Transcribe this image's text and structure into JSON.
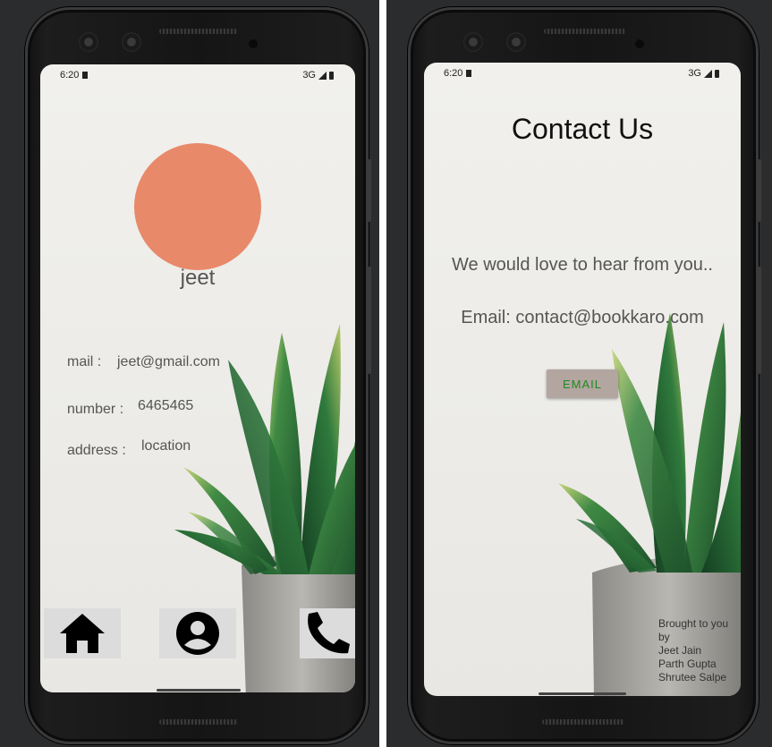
{
  "status_bar": {
    "time": "6:20",
    "network": "3G"
  },
  "profile": {
    "name": "jeet",
    "fields": [
      {
        "label": "mail :",
        "value": "jeet@gmail.com"
      },
      {
        "label": "number :",
        "value": "6465465"
      },
      {
        "label": "address :",
        "value": "location"
      }
    ],
    "avatar_color": "#e8896a"
  },
  "nav": {
    "items": [
      {
        "icon": "home-icon"
      },
      {
        "icon": "profile-icon"
      },
      {
        "icon": "phone-icon"
      }
    ]
  },
  "contact": {
    "title": "Contact Us",
    "message": "We would love to hear from you..",
    "email_line": "Email: contact@bookkaro.com",
    "email_button": "EMAIL",
    "credits": [
      "Brought to you",
      "by",
      "Jeet Jain",
      "Parth Gupta",
      "Shrutee Salpe"
    ]
  },
  "colors": {
    "email_button_bg": "#b3a5a0",
    "email_button_text": "#1f8a1f"
  }
}
